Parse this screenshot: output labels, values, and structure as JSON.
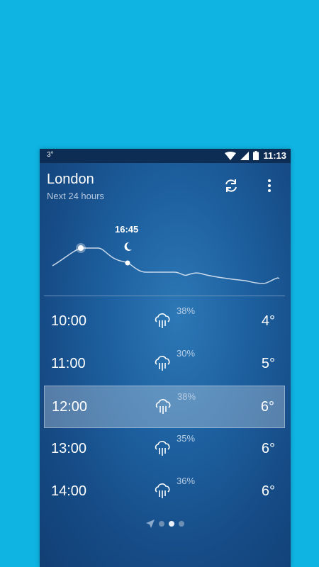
{
  "status": {
    "temp": "3°",
    "time": "11:13"
  },
  "header": {
    "city": "London",
    "subtitle": "Next 24 hours"
  },
  "chart_data": {
    "type": "line",
    "annotation": "16:45",
    "annotation_icon": "moon-icon"
  },
  "hours": [
    {
      "time": "10:00",
      "precip": "38%",
      "temp": "4°",
      "icon": "rain-cloud-icon"
    },
    {
      "time": "11:00",
      "precip": "30%",
      "temp": "5°",
      "icon": "rain-cloud-icon"
    },
    {
      "time": "12:00",
      "precip": "38%",
      "temp": "6°",
      "icon": "rain-cloud-icon",
      "selected": true
    },
    {
      "time": "13:00",
      "precip": "35%",
      "temp": "6°",
      "icon": "rain-cloud-icon"
    },
    {
      "time": "14:00",
      "precip": "36%",
      "temp": "6°",
      "icon": "rain-cloud-icon"
    }
  ],
  "pager": {
    "active_index": 2,
    "count": 4,
    "first_icon": "location-arrow-icon"
  }
}
